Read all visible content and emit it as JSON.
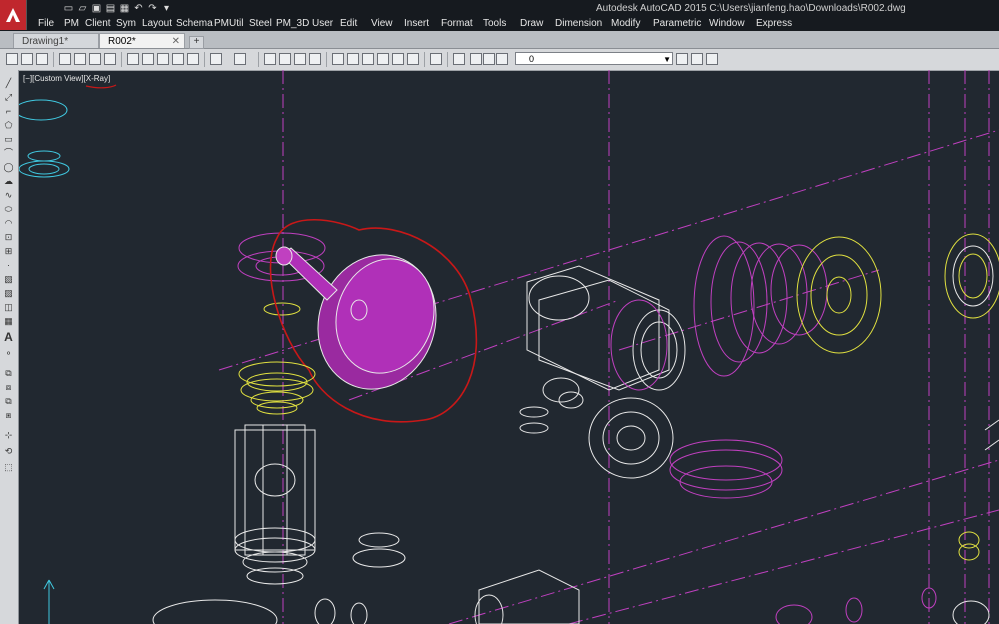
{
  "window": {
    "title": "Autodesk AutoCAD 2015    C:\\Users\\jianfeng.hao\\Downloads\\R002.dwg"
  },
  "menus": [
    "File",
    "PM",
    "Client",
    "Sym",
    "Layout",
    "Schema",
    "PMUtil",
    "Steel",
    "PM_3D",
    "User",
    "Edit",
    "View",
    "Insert",
    "Format",
    "Tools",
    "Draw",
    "Dimension",
    "Modify",
    "Parametric",
    "Window",
    "Express"
  ],
  "tabs": [
    {
      "label": "Drawing1*",
      "active": false
    },
    {
      "label": "R002*",
      "active": true
    }
  ],
  "toolbar": {
    "layer_value": "0"
  },
  "viewport": {
    "label": "[−][Custom View][X-Ray]"
  },
  "colors": {
    "bg": "#212830",
    "magenta": "#c040c0",
    "yellow": "#e0e040",
    "cyan": "#40c8e0",
    "red_markup": "#c81818",
    "white": "#e8e8e8"
  }
}
